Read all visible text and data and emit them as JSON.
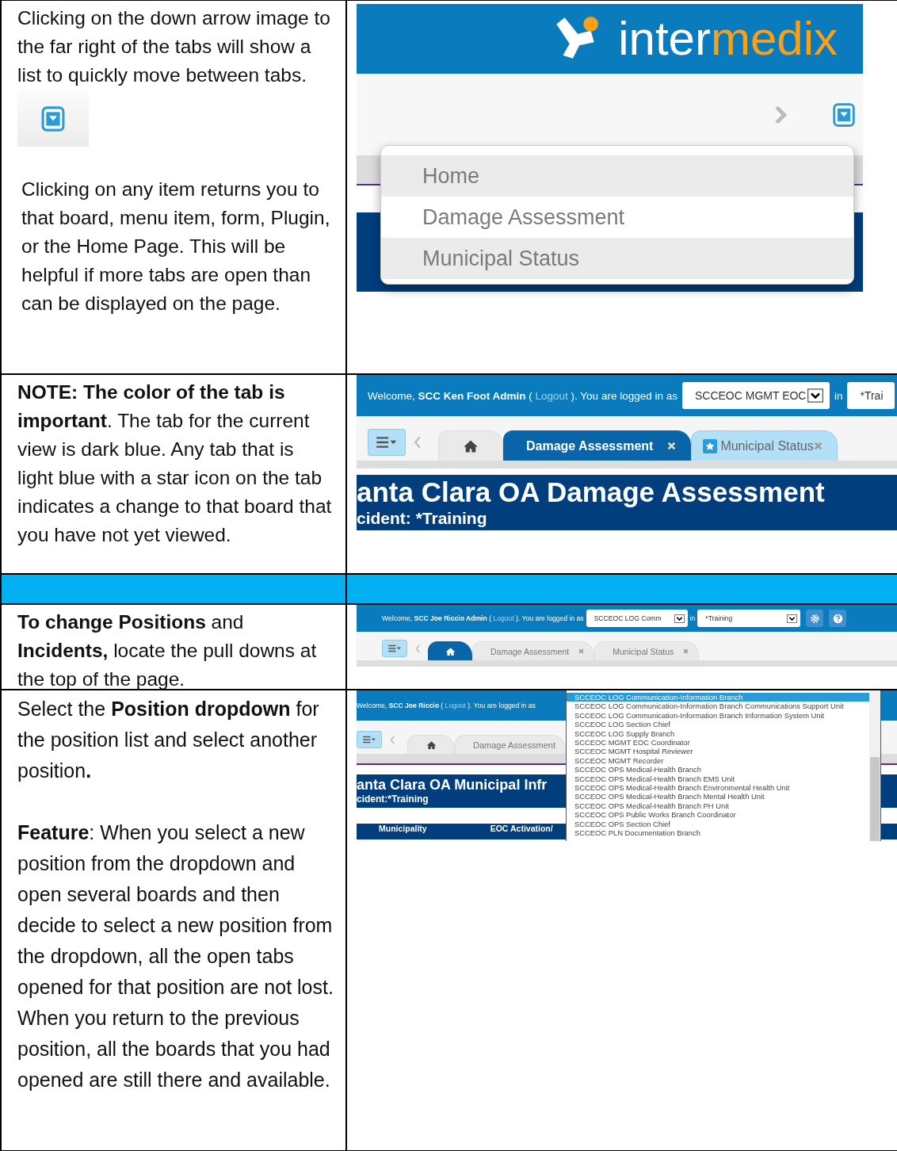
{
  "tab_menu": {
    "paragraphs": [
      "Clicking on the down arrow image to the far right of the tabs will show a list to quickly move between tabs.",
      "Clicking on any item returns you to that board, menu item, form, Plugin, or the Home Page.  This will be helpful if more tabs are open than can be displayed on the page."
    ],
    "screenshot": {
      "logo_text": "inter",
      "logo_accent": "medix",
      "menu_items": [
        {
          "label": "Home",
          "highlighted": true
        },
        {
          "label": "Damage Assessment",
          "highlighted": false
        },
        {
          "label": "Municipal Status",
          "highlighted": true
        }
      ]
    }
  },
  "tab_colors": {
    "paragraph": "**NOTE:  The color of the tab is important**.  The tab for the current view is dark blue.  Any tab that is light blue with a star icon on the tab indicates a change to that board that you have not yet viewed.",
    "screenshot": {
      "welcome": {
        "greeting": "Welcome, **SCC Ken Foot Admin** (",
        "logout": "Logout",
        "suffix": "). You are logged in as",
        "position": "SCCEOC MGMT EOC",
        "in": "in",
        "incident": "*Trai"
      },
      "tabs": [
        {
          "kind": "home",
          "selected": false
        },
        {
          "kind": "board",
          "label": "Damage Assessment",
          "selected": true,
          "starred": false
        },
        {
          "kind": "board",
          "label": "Municipal Status",
          "selected": false,
          "starred": true
        }
      ],
      "title": "anta Clara OA Damage Assessment",
      "subtitle": "cident: *Training"
    }
  },
  "pulldowns": {
    "paragraph": "**To change Positions** and **Incidents,** locate the pull downs at the top of the page.",
    "screenshot": {
      "welcome": {
        "greeting": "Welcome, **SCC Joe Riccio Admin** (",
        "logout": "Logout",
        "suffix": "). You are logged in as",
        "position": "SCCEOC LOG Comm",
        "in": "in",
        "incident": "*Training"
      },
      "tabs": [
        {
          "kind": "home",
          "selected": true
        },
        {
          "kind": "board",
          "label": "Damage Assessment",
          "selected": false,
          "starred": false
        },
        {
          "kind": "board",
          "label": "Municipal Status",
          "selected": false,
          "starred": false
        }
      ]
    }
  },
  "position_list": {
    "paragraphs": [
      "Select the **Position dropdown** for the position list and select another position**.**",
      "**Feature**:  When you select a new position from the dropdown and open several boards and then decide to select a new position from the dropdown, all the open tabs opened for that position are not lost.  When you return to the previous position, all the boards that you had opened are still there and available."
    ],
    "screenshot": {
      "welcome": {
        "greeting": "Welcome, **SCC Joe Riccio** (",
        "logout": "Logout",
        "suffix": "). You are logged in as"
      },
      "tabs": [
        {
          "kind": "home",
          "selected": false
        },
        {
          "kind": "board",
          "label": "Damage Assessment",
          "selected": false,
          "starred": false
        }
      ],
      "title": "anta Clara OA Municipal Infr",
      "subtitle": "cident:*Training",
      "columns": [
        "Municipality",
        "EOC Activation/"
      ],
      "options": [
        {
          "label": "SCCEOC LOG Communication-Information Branch",
          "selected": true
        },
        {
          "label": "SCCEOC LOG Communication-Information Branch Communications Support Unit",
          "selected": false
        },
        {
          "label": "SCCEOC LOG Communication-Information Branch Information System Unit",
          "selected": false
        },
        {
          "label": "SCCEOC LOG Section Chief",
          "selected": false
        },
        {
          "label": "SCCEOC LOG Supply Branch",
          "selected": false
        },
        {
          "label": "SCCEOC MGMT EOC Coordinator",
          "selected": false
        },
        {
          "label": "SCCEOC MGMT Hospital Reviewer",
          "selected": false
        },
        {
          "label": "SCCEOC MGMT Recorder",
          "selected": false
        },
        {
          "label": "SCCEOC OPS Medical-Health Branch",
          "selected": false
        },
        {
          "label": "SCCEOC OPS Medical-Health Branch EMS Unit",
          "selected": false
        },
        {
          "label": "SCCEOC OPS Medical-Health Branch Environmental Health Unit",
          "selected": false
        },
        {
          "label": "SCCEOC OPS Medical-Health Branch Mental Health Unit",
          "selected": false
        },
        {
          "label": "SCCEOC OPS Medical-Health Branch PH Unit",
          "selected": false
        },
        {
          "label": "SCCEOC OPS Public Works Branch Coordinator",
          "selected": false
        },
        {
          "label": "SCCEOC OPS Section Chief",
          "selected": false
        },
        {
          "label": "SCCEOC PLN Documentation Branch",
          "selected": false
        }
      ]
    }
  }
}
